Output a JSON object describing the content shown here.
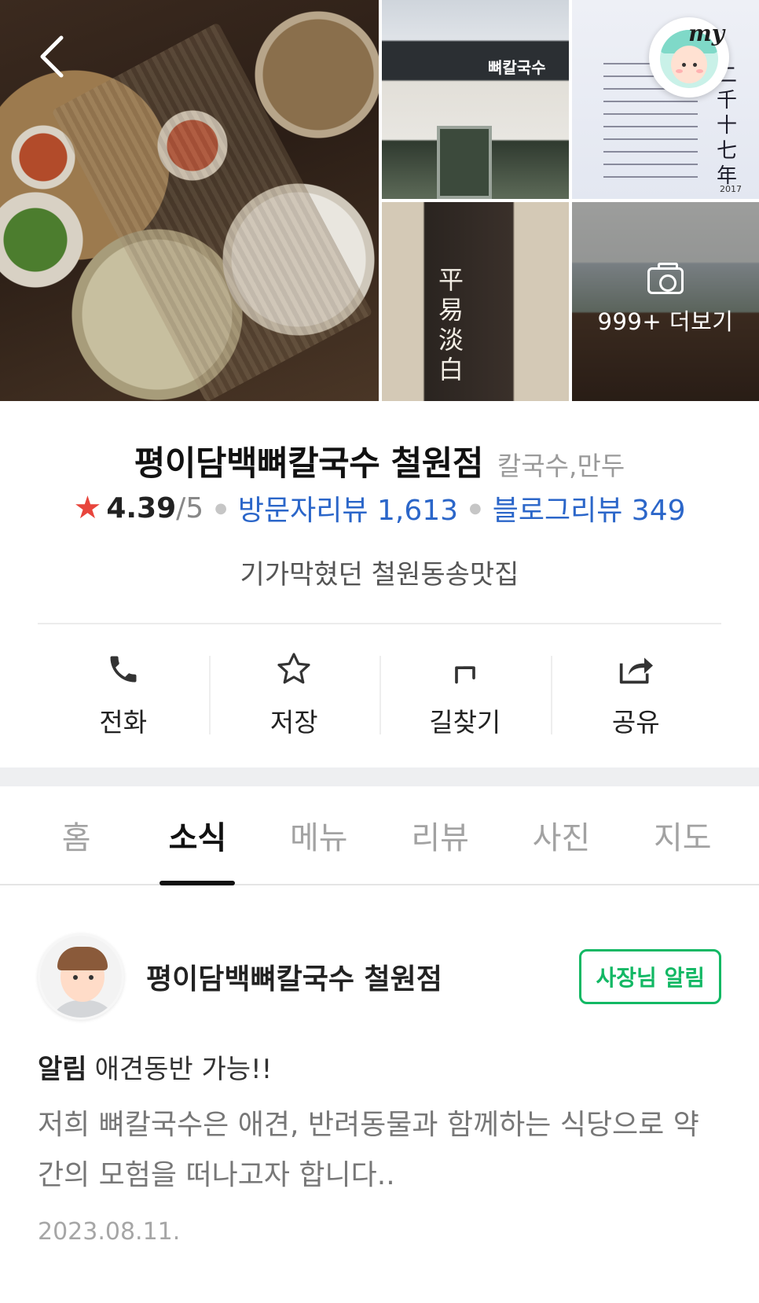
{
  "gallery": {
    "more_label": "999+ 더보기",
    "store_sign": "뼈칼국수",
    "wood_text": "平易淡白",
    "poster_text": "二千十七年",
    "poster_year": "2017",
    "my_label": "my"
  },
  "place": {
    "name": "평이담백뼈칼국수 철원점",
    "category": "칼국수,만두",
    "rating": "4.39",
    "rating_max": "/5",
    "visitor_reviews": "방문자리뷰 1,613",
    "blog_reviews": "블로그리뷰 349",
    "tagline": "기가막혔던 철원동송맛집"
  },
  "actions": [
    {
      "label": "전화",
      "icon": "phone-icon"
    },
    {
      "label": "저장",
      "icon": "star-outline-icon"
    },
    {
      "label": "길찾기",
      "icon": "directions-icon"
    },
    {
      "label": "공유",
      "icon": "share-icon"
    }
  ],
  "tabs": [
    {
      "label": "홈",
      "active": false
    },
    {
      "label": "소식",
      "active": true
    },
    {
      "label": "메뉴",
      "active": false
    },
    {
      "label": "리뷰",
      "active": false
    },
    {
      "label": "사진",
      "active": false
    },
    {
      "label": "지도",
      "active": false
    }
  ],
  "notice": {
    "owner_name": "평이담백뼈칼국수 철원점",
    "badge": "사장님 알림",
    "tag": "알림",
    "title": "애견동반 가능!!",
    "body": "저희 뼈칼국수은 애견, 반려동물과 함께하는 식당으로 약간의 모험을 떠나고자 합니다..",
    "date": "2023.08.11."
  },
  "colors": {
    "rating_star": "#e8453c",
    "link_blue": "#2b66c9",
    "owner_badge_green": "#12b864"
  }
}
